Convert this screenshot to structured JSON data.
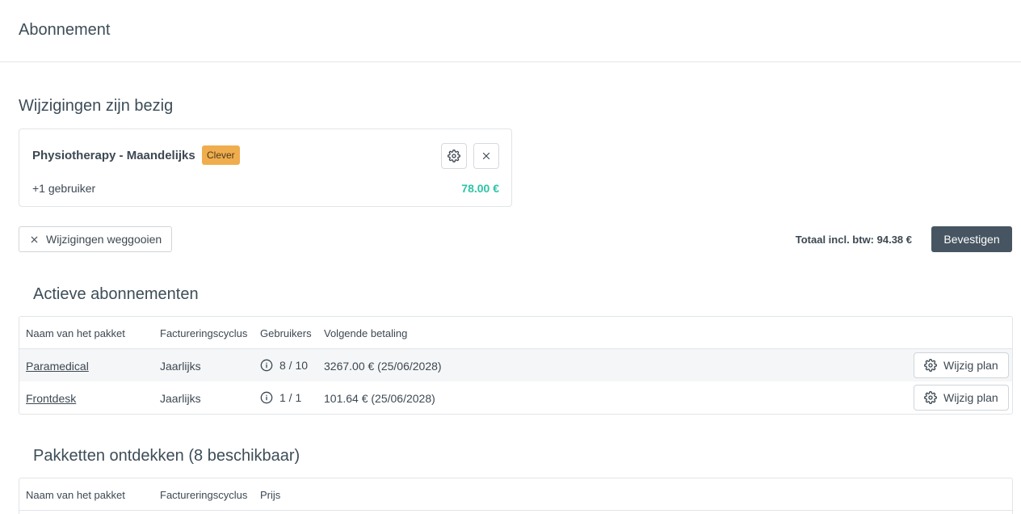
{
  "header": {
    "title": "Abonnement"
  },
  "changes": {
    "title": "Wijzigingen zijn bezig",
    "card": {
      "plan_name": "Physiotherapy - Maandelijks",
      "badge": "Clever",
      "users": "+1 gebruiker",
      "price": "78.00 €"
    },
    "discard_label": "Wijzigingen weggooien",
    "total": "Totaal incl. btw: 94.38 €",
    "confirm_label": "Bevestigen"
  },
  "active": {
    "title": "Actieve abonnementen",
    "columns": [
      "Naam van het pakket",
      "Factureringscyclus",
      "Gebruikers",
      "Volgende betaling"
    ],
    "rows": [
      {
        "name": "Paramedical",
        "cycle": "Jaarlijks",
        "users": "8 / 10",
        "next": "3267.00 € (25/06/2028)",
        "action": "Wijzig plan"
      },
      {
        "name": "Frontdesk",
        "cycle": "Jaarlijks",
        "users": "1 / 1",
        "next": "101.64 € (25/06/2028)",
        "action": "Wijzig plan"
      }
    ]
  },
  "discover": {
    "title": "Pakketten ontdekken (8 beschikbaar)",
    "columns": [
      "Naam van het pakket",
      "Factureringscyclus",
      "Prijs"
    ]
  },
  "icons": {
    "settings": "gear-icon",
    "close": "close-icon",
    "info": "info-icon"
  },
  "colors": {
    "badge": "#f0ad4e",
    "price": "#2ec4a6",
    "confirm": "#465561"
  }
}
